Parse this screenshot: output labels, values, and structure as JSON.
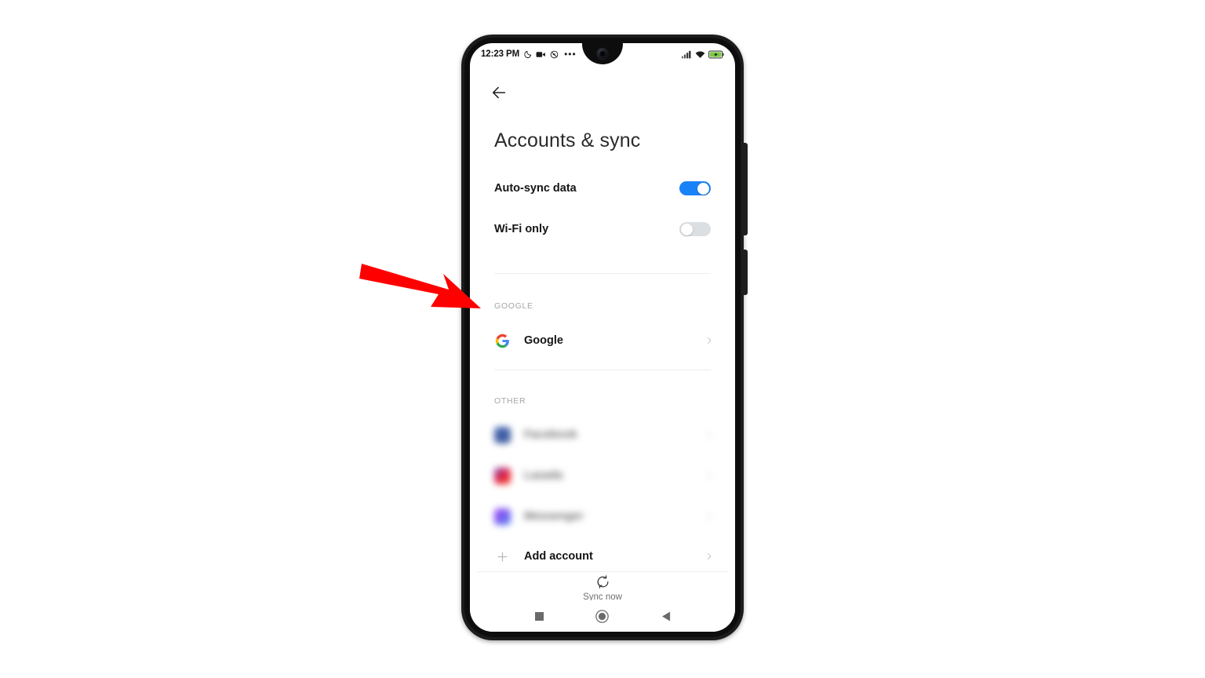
{
  "device": {
    "type": "android-phone",
    "frame_color": "#1c1c1c",
    "buttons": [
      "volume-rocker",
      "power-button"
    ]
  },
  "status_bar": {
    "clock": "12:23 PM",
    "left_icons": [
      "moon-dnd-icon",
      "video-camera-icon",
      "no-sound-icon",
      "overflow-dots-icon"
    ],
    "right_icons": [
      "signal-bars-icon",
      "wifi-icon",
      "battery-charging-icon"
    ],
    "battery_color": "#7ac943"
  },
  "header": {
    "back_icon": "arrow-left-icon",
    "title": "Accounts & sync"
  },
  "preferences": [
    {
      "label": "Auto-sync data",
      "state": "on",
      "accent": "#1a82f7"
    },
    {
      "label": "Wi-Fi only",
      "state": "off",
      "accent": "#dcdfe2"
    }
  ],
  "sections": [
    {
      "header": "GOOGLE",
      "accounts": [
        {
          "label": "Google",
          "icon": "google-logo-icon",
          "blurred": false
        }
      ]
    },
    {
      "header": "OTHER",
      "accounts": [
        {
          "label": "Facebook",
          "icon": "facebook-app-icon",
          "blurred": true,
          "color": "#3b5998"
        },
        {
          "label": "Lazada",
          "icon": "lazada-app-icon",
          "blurred": true,
          "color": "#e8243c"
        },
        {
          "label": "Messenger",
          "icon": "messenger-app-icon",
          "blurred": true,
          "color": "#7a5cf0"
        }
      ]
    }
  ],
  "add_account": {
    "label": "Add account",
    "icon": "plus-icon",
    "chevron": "chevron-right-icon"
  },
  "sync_now": {
    "label": "Sync now",
    "icon": "refresh-icon"
  },
  "nav_bar": {
    "recents": "square-icon",
    "home": "circle-icon",
    "back": "triangle-left-icon"
  },
  "annotation": {
    "type": "arrow",
    "color": "#FF0000",
    "points_to": "Google"
  }
}
